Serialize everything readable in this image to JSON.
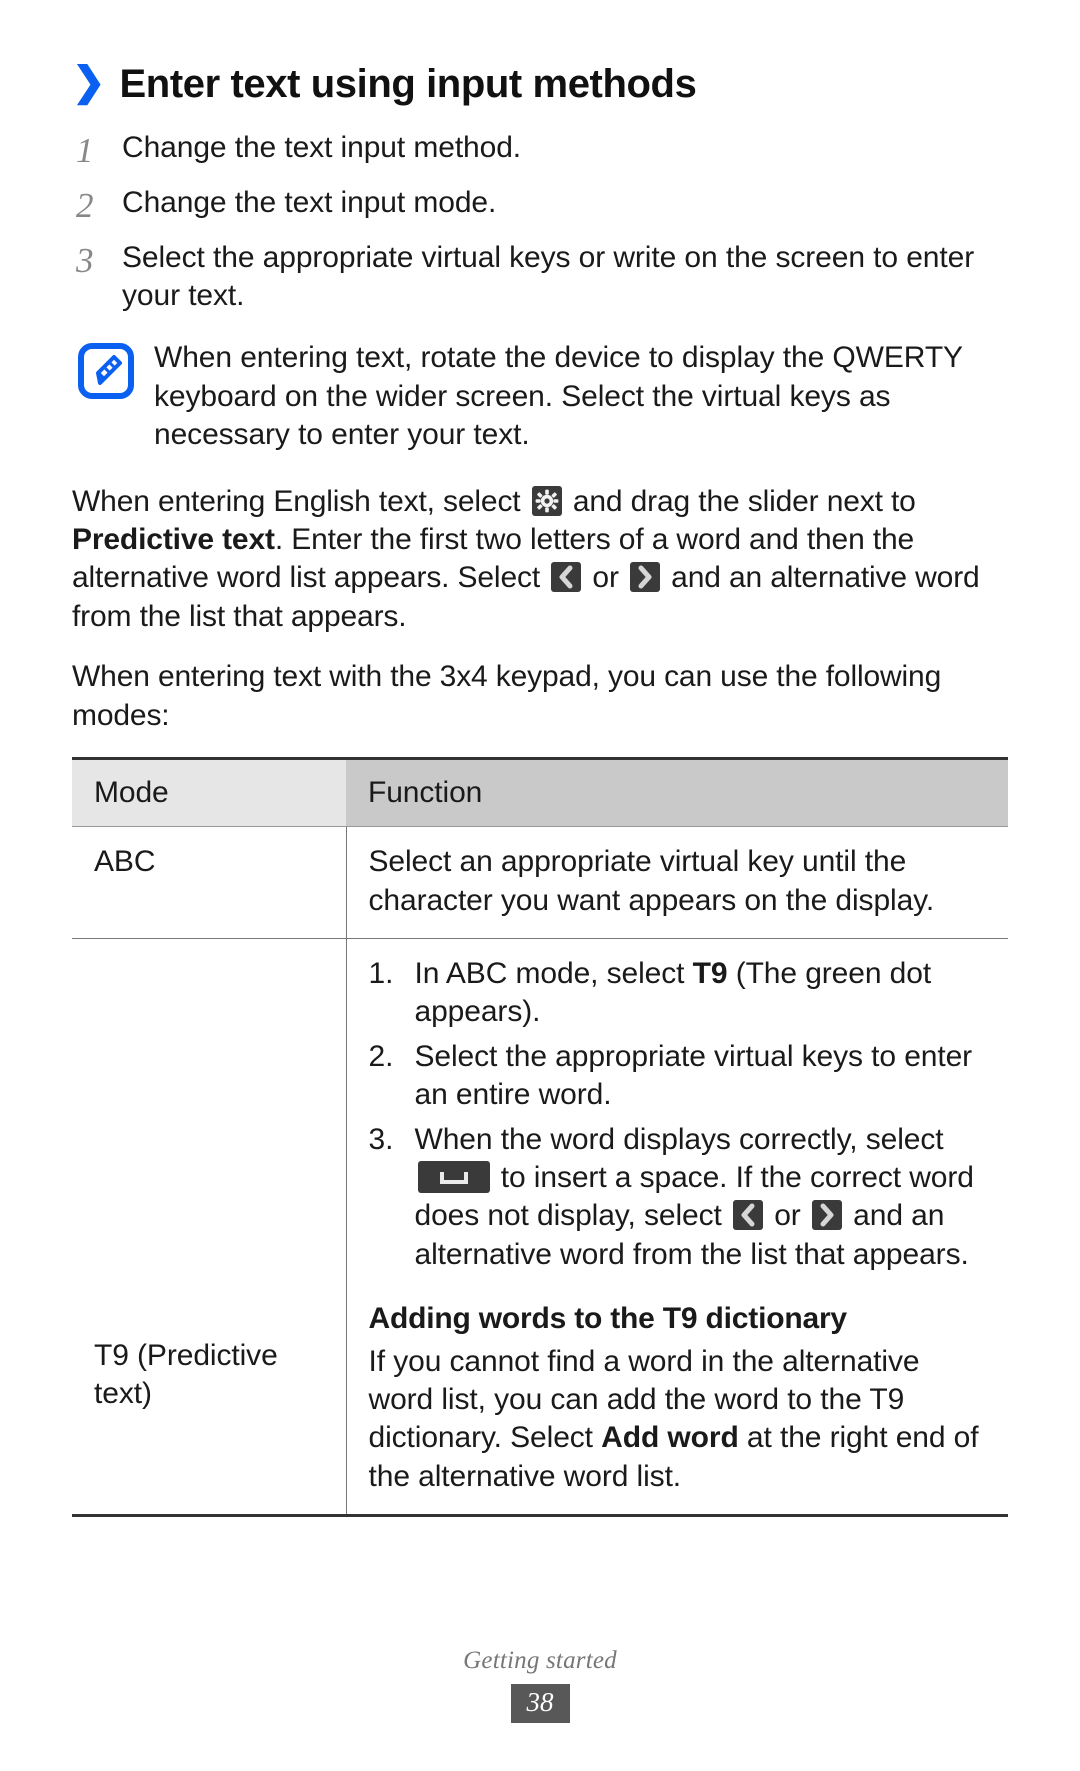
{
  "heading": {
    "chevron_icon": "chevron-right-icon",
    "text": "Enter text using input methods"
  },
  "steps": [
    {
      "num": "1",
      "text": "Change the text input method."
    },
    {
      "num": "2",
      "text": "Change the text input mode."
    },
    {
      "num": "3",
      "text": "Select the appropriate virtual keys or write on the screen to enter your text."
    }
  ],
  "note": {
    "icon": "note-pencil-icon",
    "text": "When entering text, rotate the device to display the QWERTY keyboard on the wider screen. Select the virtual keys as necessary to enter your text."
  },
  "paragraphs": {
    "english_text": {
      "part1": "When entering English text, select ",
      "gear_icon": "gear-icon",
      "part2": " and drag the slider next to ",
      "bold1": "Predictive text",
      "part3": ". Enter the first two letters of a word and then the alternative word list appears. Select ",
      "left_icon": "chevron-left-key-icon",
      "part4": " or ",
      "right_icon": "chevron-right-key-icon",
      "part5": " and an alternative word from the list that appears."
    },
    "keypad_intro": "When entering text with the 3x4 keypad, you can use the following modes:"
  },
  "table": {
    "headers": {
      "mode": "Mode",
      "function": "Function"
    },
    "rows": [
      {
        "mode": "ABC",
        "function": "Select an appropriate virtual key until the character you want appears on the display."
      },
      {
        "mode": "T9 (Predictive text)",
        "list": [
          {
            "num": "1.",
            "part1": "In ABC mode, select ",
            "bold": "T9",
            "part2": " (The green dot appears)."
          },
          {
            "num": "2.",
            "part1": "Select the appropriate virtual keys to enter an entire word.",
            "bold": "",
            "part2": ""
          },
          {
            "num": "3.",
            "part1": "When the word displays correctly, select ",
            "space_icon": "space-key-icon",
            "part2": " to insert a space. If the correct word does not display, select ",
            "left_icon": "chevron-left-key-icon",
            "part3": " or ",
            "right_icon": "chevron-right-key-icon",
            "part4": " and an alternative word from the list that appears."
          }
        ],
        "subheading": "Adding words to the T9 dictionary",
        "sub_part1": "If you cannot find a word in the alternative word list, you can add the word to the T9 dictionary. Select ",
        "sub_bold": "Add word",
        "sub_part2": " at the right end of the alternative word list."
      }
    ]
  },
  "footer": {
    "label": "Getting started",
    "page": "38"
  },
  "colors": {
    "accent_blue": "#0a60f0",
    "key_dark": "#3a3a3a",
    "header_mode_bg": "#e6e6e6",
    "header_function_bg": "#c9c9c9",
    "footer_page_bg": "#585858"
  }
}
